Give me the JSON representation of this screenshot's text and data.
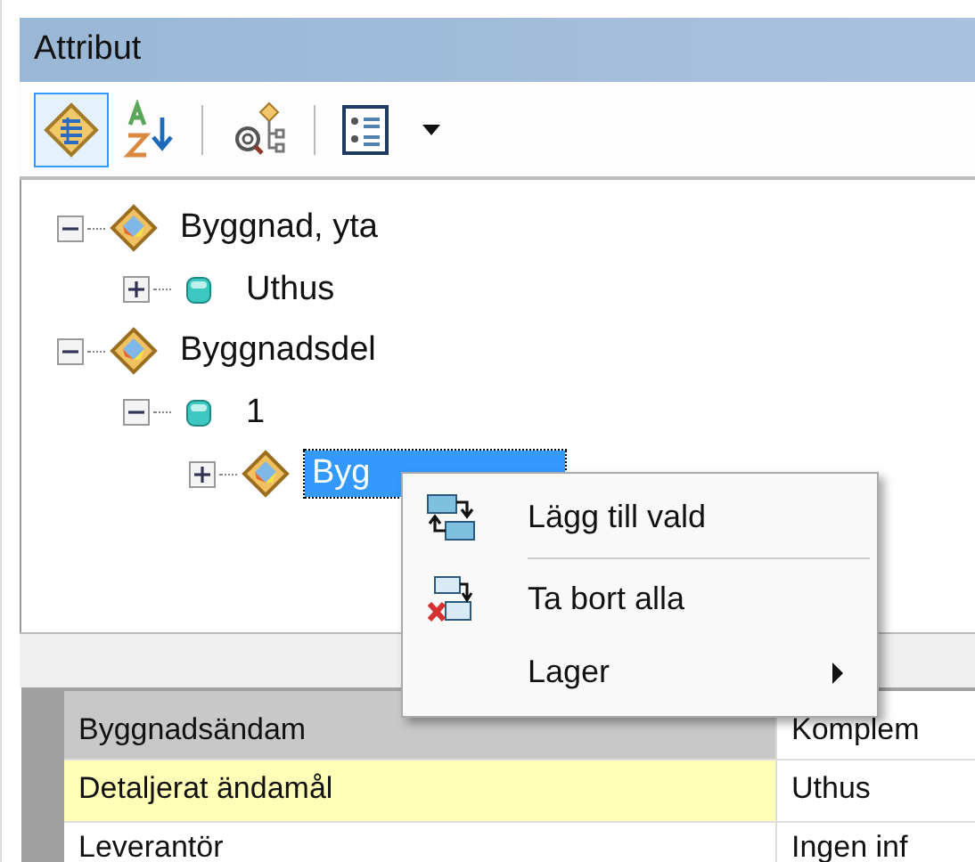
{
  "panel": {
    "title": "Attribut"
  },
  "toolbar": [
    {
      "kind": "attributes",
      "selected": true
    },
    {
      "kind": "sort",
      "selected": false
    },
    {
      "kind": "separator"
    },
    {
      "kind": "locate",
      "selected": false
    },
    {
      "kind": "separator"
    },
    {
      "kind": "list",
      "selected": false
    },
    {
      "kind": "dropdown",
      "selected": false
    }
  ],
  "tree": [
    {
      "label": "Byggnad, yta",
      "kind": "layer",
      "expanded": true,
      "selected": false,
      "children": [
        {
          "label": "Uthus",
          "kind": "feature",
          "expanded": false,
          "selected": false
        }
      ]
    },
    {
      "label": "Byggnadsdel",
      "kind": "layer",
      "expanded": true,
      "selected": false,
      "children": [
        {
          "label": "1",
          "kind": "feature",
          "expanded": true,
          "selected": false,
          "children": [
            {
              "label": "Byg",
              "kind": "layer",
              "expanded": false,
              "selected": true
            }
          ]
        }
      ]
    }
  ],
  "context_menu": [
    {
      "label": "Lägg till vald",
      "kind": "add"
    },
    {
      "kind": "separator"
    },
    {
      "label": "Ta bort alla",
      "kind": "remove"
    },
    {
      "label": "Lager",
      "kind": "submenu"
    }
  ],
  "properties": [
    {
      "name": "Byggnadsändam",
      "value": "Komplem",
      "selected": false
    },
    {
      "name": "Detaljerat ändamål",
      "value": "Uthus",
      "selected": true
    },
    {
      "name": "Leverantör",
      "value": "Ingen inf",
      "selected": false
    }
  ]
}
